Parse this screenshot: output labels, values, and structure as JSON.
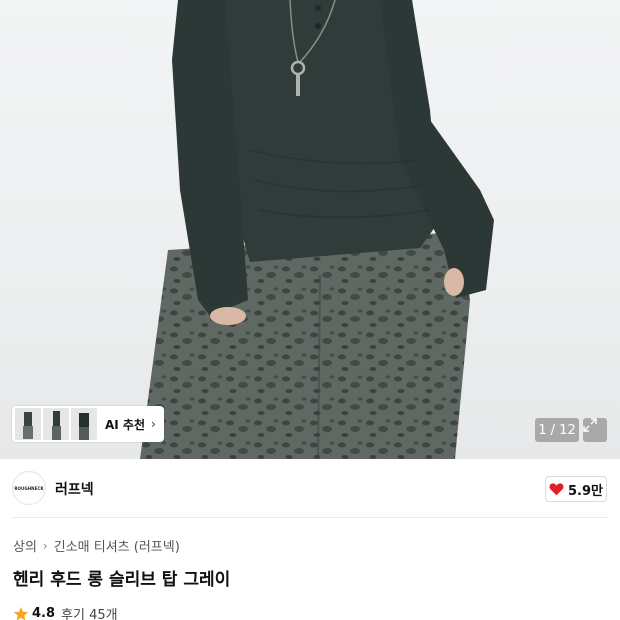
{
  "gallery": {
    "ai_label": "AI 추천",
    "counter": "1 / 12",
    "colors": {
      "sweater": "#2f3c3a",
      "pants": "#5d6560",
      "skin": "#d9b8a6",
      "background": "#eceeef"
    }
  },
  "brand": {
    "logo_text": "ROUGHNECK",
    "name": "러프넥",
    "likes": "5.9만"
  },
  "breadcrumb": {
    "level1": "상의",
    "level2": "긴소매 티셔츠 (러프넥)"
  },
  "product": {
    "title": "헨리 후드 롱 슬리브 탑 그레이"
  },
  "rating": {
    "score": "4.8",
    "reviews": "후기 45개",
    "star_color": "#f5a623"
  },
  "icons": {
    "like": "heart-icon",
    "expand": "expand-icon",
    "star": "star-icon",
    "chevron": "chevron-right-icon"
  }
}
